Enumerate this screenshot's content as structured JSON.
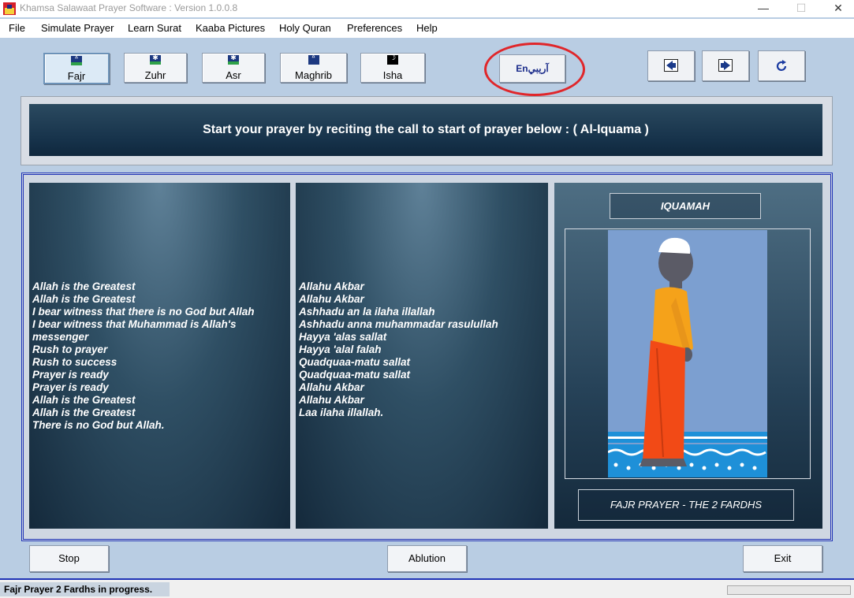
{
  "window": {
    "title": "Khamsa Salawaat Prayer Software : Version 1.0.0.8",
    "min_glyph": "—",
    "max_glyph": "☐",
    "close_glyph": "✕"
  },
  "menu": [
    "File",
    "Simulate Prayer",
    "Learn Surat",
    "Kaaba Pictures",
    "Holy Quran",
    "Preferences",
    "Help"
  ],
  "prayers": [
    {
      "label": "Fajr",
      "icon": "dawn-icon",
      "glyph": "ᐞ",
      "selected": true
    },
    {
      "label": "Zuhr",
      "icon": "sun-icon",
      "glyph": "✱",
      "selected": false
    },
    {
      "label": "Asr",
      "icon": "afternoon-sun-icon",
      "glyph": "✱",
      "selected": false
    },
    {
      "label": "Maghrib",
      "icon": "sunset-icon",
      "glyph": "ᐞ",
      "selected": false
    },
    {
      "label": "Isha",
      "icon": "moon-icon",
      "glyph": "☽",
      "selected": false
    }
  ],
  "language_toggle": {
    "label": "Enآريبي",
    "icon": "language-icon"
  },
  "nav": {
    "prev_icon": "arrow-left-icon",
    "next_icon": "arrow-right-icon",
    "refresh_icon": "refresh-icon"
  },
  "banner": "Start your prayer by reciting the call to start of prayer below : ( Al-Iquama )",
  "english_lines": [
    "Allah is the Greatest",
    "Allah is the Greatest",
    "I bear witness that there is no God but Allah",
    "I bear witness that Muhammad is Allah's",
    "messenger",
    "Rush to prayer",
    "Rush to success",
    "Prayer is ready",
    "Prayer is ready",
    "Allah is the Greatest",
    "Allah is the Greatest",
    "There is no God but Allah."
  ],
  "transliteration_lines": [
    "Allahu Akbar",
    "Allahu Akbar",
    "Ashhadu an la ilaha illallah",
    "Ashhadu anna muhammadar rasulullah",
    "Hayya 'alas sallat",
    "Hayya 'alal falah",
    "Quadquaa-matu sallat",
    "Quadquaa-matu sallat",
    "Allahu Akbar",
    "Allahu Akbar",
    "Laa ilaha illallah."
  ],
  "image_panel": {
    "label": "IQUAMAH",
    "caption": "FAJR PRAYER - THE 2 FARDHS"
  },
  "buttons": {
    "stop": "Stop",
    "ablution": "Ablution",
    "exit": "Exit"
  },
  "status": {
    "text": "Fajr Prayer 2 Fardhs in progress.",
    "progress": 0
  },
  "colors": {
    "accent_border": "#1f33b6",
    "highlight_circle": "#e0262a",
    "background": "#b9cde3"
  }
}
